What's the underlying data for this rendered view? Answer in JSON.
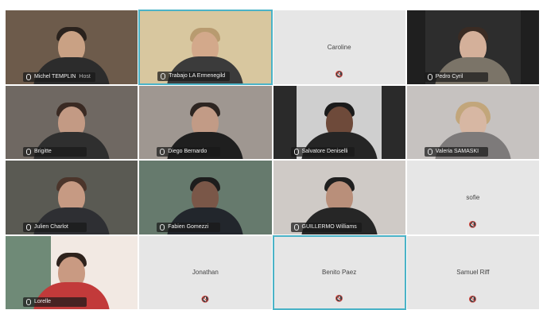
{
  "participants": [
    {
      "name": "Michel TEMPLIN",
      "extra": "Host",
      "colors": {
        "bg": "#6d5b4b",
        "body": "#2c2c2c",
        "hair": "#2a221d"
      }
    },
    {
      "name": "Trabajo LA Ermenegild",
      "extra": "",
      "colors": {
        "bg": "#d8c79f",
        "body": "#3b3b3b",
        "hair": "#b89b70"
      }
    },
    {
      "name": "Caroline",
      "extra": "",
      "empty": true
    },
    {
      "name": "Pedro Cyril",
      "extra": "",
      "colors": {
        "bg": "#1f1f1f",
        "body": "#7b7468",
        "hair": "#3a2b23"
      }
    },
    {
      "name": "Brigitte",
      "extra": "",
      "colors": {
        "bg": "#6f6862",
        "body": "#2f2f2f",
        "hair": "#3a2a23"
      }
    },
    {
      "name": "Diego Bernardo",
      "extra": "",
      "colors": {
        "bg": "#9f9791",
        "body": "#1f1f1f",
        "hair": "#2d2521"
      }
    },
    {
      "name": "Salvatore Deniselli",
      "extra": "",
      "colors": {
        "bg": "#2a2a2a",
        "body": "#252525",
        "hair": "#1b1b1b"
      }
    },
    {
      "name": "Valeria SAMASKI",
      "extra": "",
      "colors": {
        "bg": "#c6c2c0",
        "body": "#7d7a7a",
        "hair": "#c2a67b"
      }
    },
    {
      "name": "Julien Charlot",
      "extra": "",
      "colors": {
        "bg": "#5a5a53",
        "body": "#2e2f33",
        "hair": "#4b352b"
      }
    },
    {
      "name": "Fabien Gomezzi",
      "extra": "",
      "colors": {
        "bg": "#667a6d",
        "body": "#22262c",
        "hair": "#1d1d1d"
      }
    },
    {
      "name": "GUILLERMO Williams",
      "extra": "",
      "colors": {
        "bg": "#cfcac6",
        "body": "#262626",
        "hair": "#1f1f1f"
      }
    },
    {
      "name": "sofie",
      "extra": "",
      "empty": true
    },
    {
      "name": "Lorelle",
      "extra": "",
      "colors": {
        "bg": "#f2e9e3",
        "body": "#c23a3a",
        "hair": "#2e221c"
      }
    },
    {
      "name": "Jonathan",
      "extra": "",
      "empty": true
    },
    {
      "name": "Benito Paez",
      "extra": "",
      "empty": true
    },
    {
      "name": "Samuel Riff",
      "extra": "",
      "empty": true
    }
  ],
  "icons": {
    "mic_muted": "🔇"
  }
}
